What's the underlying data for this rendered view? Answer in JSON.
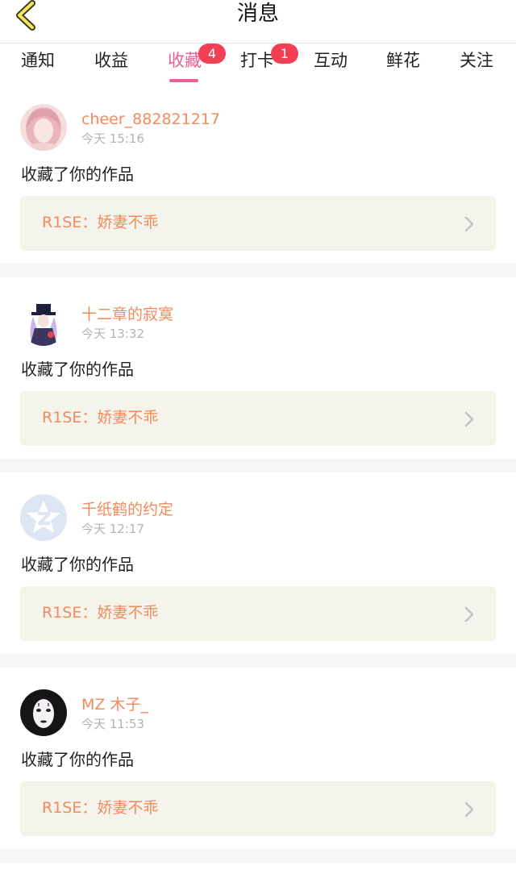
{
  "header": {
    "title": "消息"
  },
  "tabs": [
    {
      "label": "通知"
    },
    {
      "label": "收益"
    },
    {
      "label": "收藏",
      "badge": "4",
      "active": true
    },
    {
      "label": "打卡",
      "badge": "1"
    },
    {
      "label": "互动"
    },
    {
      "label": "鲜花"
    },
    {
      "label": "关注"
    }
  ],
  "colors": {
    "accent": "#e9609a",
    "badge": "#f23f53",
    "username": "#f08c5c",
    "work_bg": "#f4f4ec"
  },
  "feed": [
    {
      "username": "cheer_882821217",
      "time": "今天 15:16",
      "action": "收藏了你的作品",
      "work_title": "R1SE：娇妻不乖",
      "avatar": "pink-hair-girl-avatar"
    },
    {
      "username": "十二章的寂寞",
      "time": "今天 13:32",
      "action": "收藏了你的作品",
      "work_title": "R1SE：娇妻不乖",
      "avatar": "anime-magician-avatar"
    },
    {
      "username": "千纸鹤的约定",
      "time": "今天 12:17",
      "action": "收藏了你的作品",
      "work_title": "R1SE：娇妻不乖",
      "avatar": "default-qq-avatar"
    },
    {
      "username": "MZ 木子_",
      "time": "今天 11:53",
      "action": "收藏了你的作品",
      "work_title": "R1SE：娇妻不乖",
      "avatar": "no-face-avatar"
    }
  ]
}
